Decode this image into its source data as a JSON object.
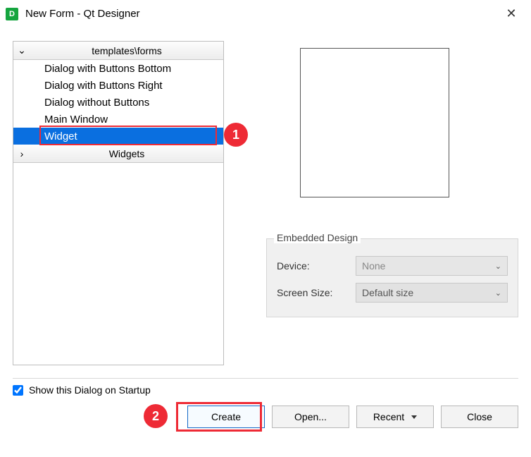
{
  "window": {
    "title": "New Form - Qt Designer"
  },
  "tree": {
    "group1_label": "templates\\forms",
    "items": [
      "Dialog with Buttons Bottom",
      "Dialog with Buttons Right",
      "Dialog without Buttons",
      "Main Window",
      "Widget"
    ],
    "group2_label": "Widgets"
  },
  "annotations": {
    "badge1": "1",
    "badge2": "2"
  },
  "embedded": {
    "group_title": "Embedded Design",
    "device_label": "Device:",
    "device_value": "None",
    "screen_label": "Screen Size:",
    "screen_value": "Default size"
  },
  "footer": {
    "checkbox_label": "Show this Dialog on Startup",
    "create": "Create",
    "open": "Open...",
    "recent": "Recent",
    "close": "Close"
  }
}
